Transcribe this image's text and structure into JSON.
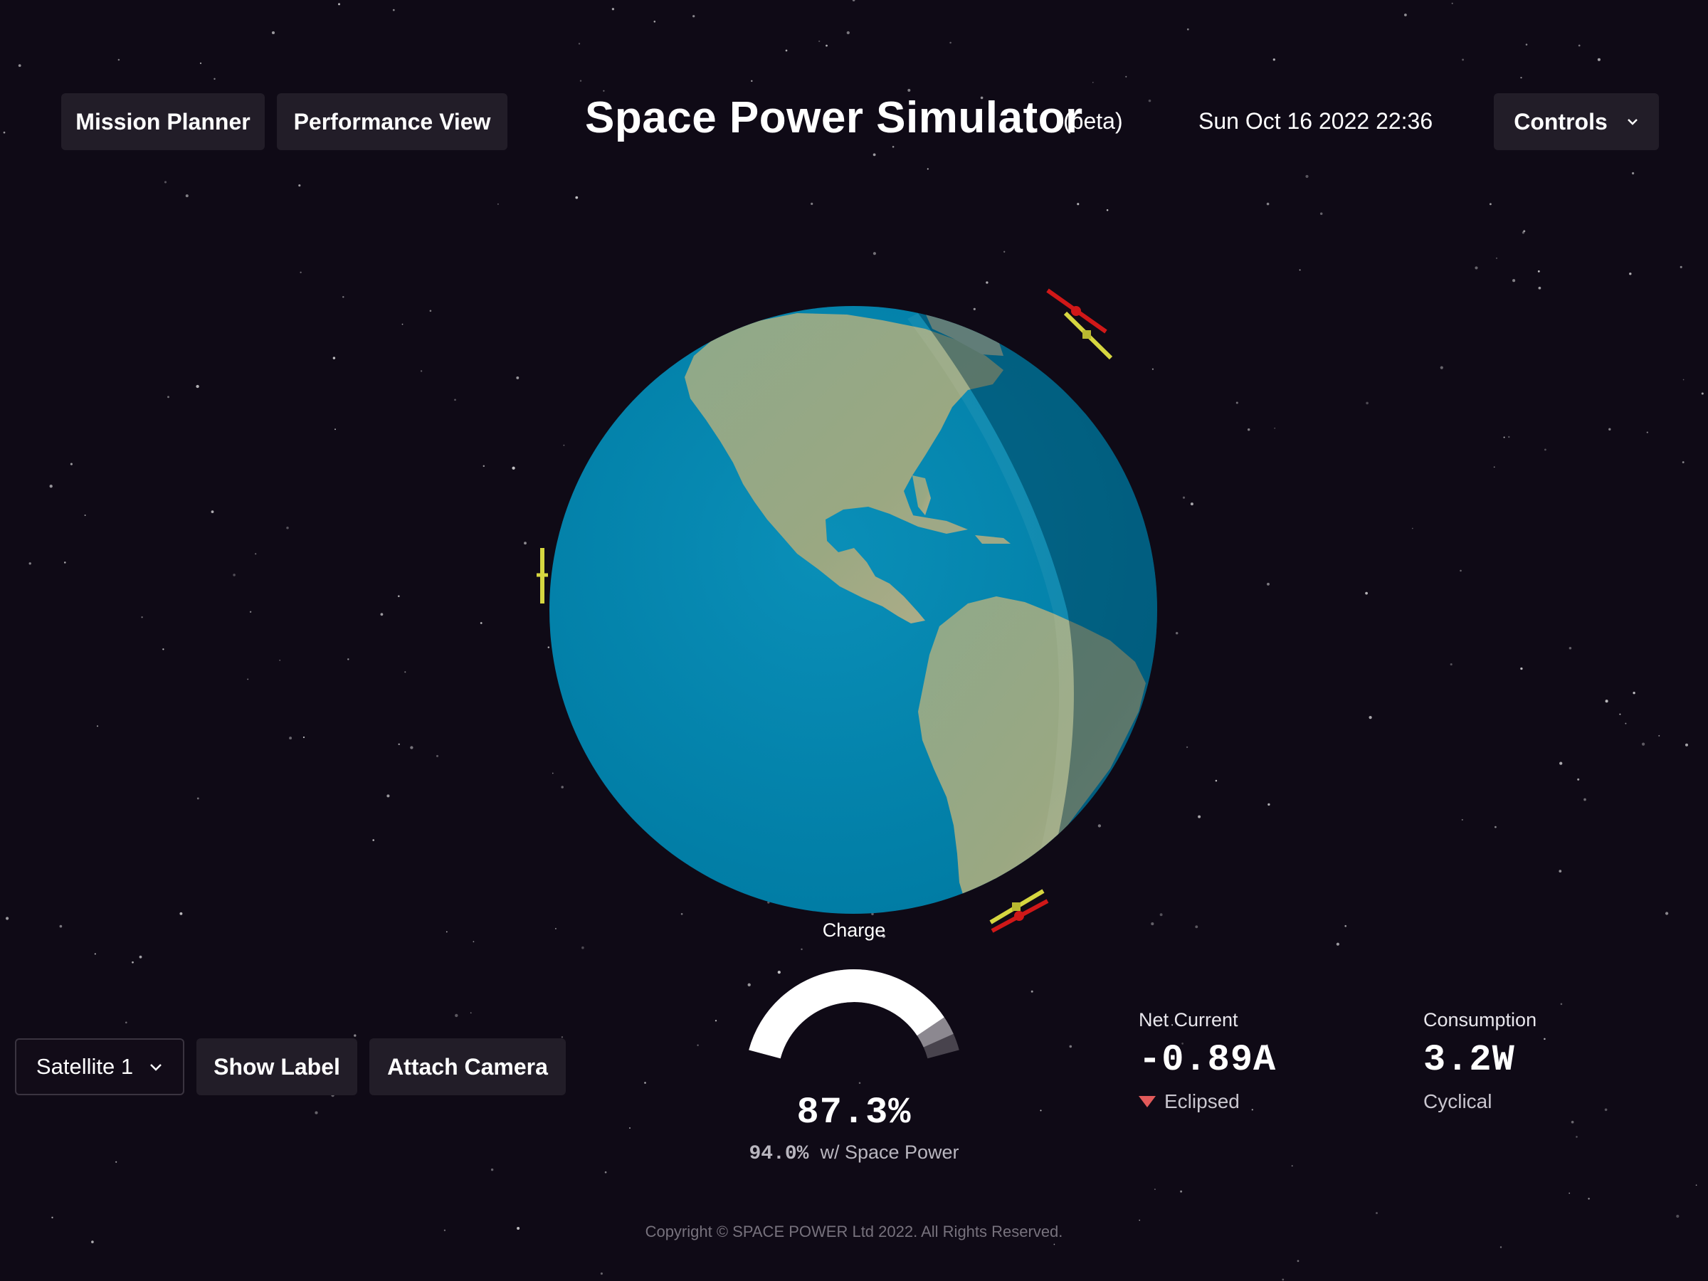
{
  "header": {
    "mission_planner_label": "Mission Planner",
    "performance_view_label": "Performance View",
    "title": "Space Power Simulator",
    "beta_tag": "(beta)",
    "datetime": "Sun Oct 16 2022 22:36",
    "controls_label": "Controls",
    "controls_icon": "chevron-down-icon"
  },
  "satellite_controls": {
    "selected_satellite": "Satellite 1",
    "select_icon": "chevron-down-icon",
    "show_label": "Show Label",
    "attach_camera": "Attach Camera"
  },
  "charge": {
    "label": "Charge",
    "value": "87.3%",
    "value_fraction": 0.873,
    "space_power_fraction": 0.94,
    "space_power_value": "94.0%",
    "space_power_label": "w/ Space Power"
  },
  "net_current": {
    "label": "Net Current",
    "value": "-0.89A",
    "status": "Eclipsed",
    "status_icon": "triangle-down-icon",
    "status_color": "#e25a5a"
  },
  "consumption": {
    "label": "Consumption",
    "value": "3.2W",
    "status": "Cyclical"
  },
  "footer": {
    "copyright": "Copyright © SPACE POWER Ltd 2022. All Rights Reserved."
  },
  "colors": {
    "background": "#0f0a16",
    "button_bg": "#221d28",
    "ocean": "#0280a8",
    "satellite_panel_red": "#d01818",
    "satellite_panel_yellow": "#d6d640"
  }
}
